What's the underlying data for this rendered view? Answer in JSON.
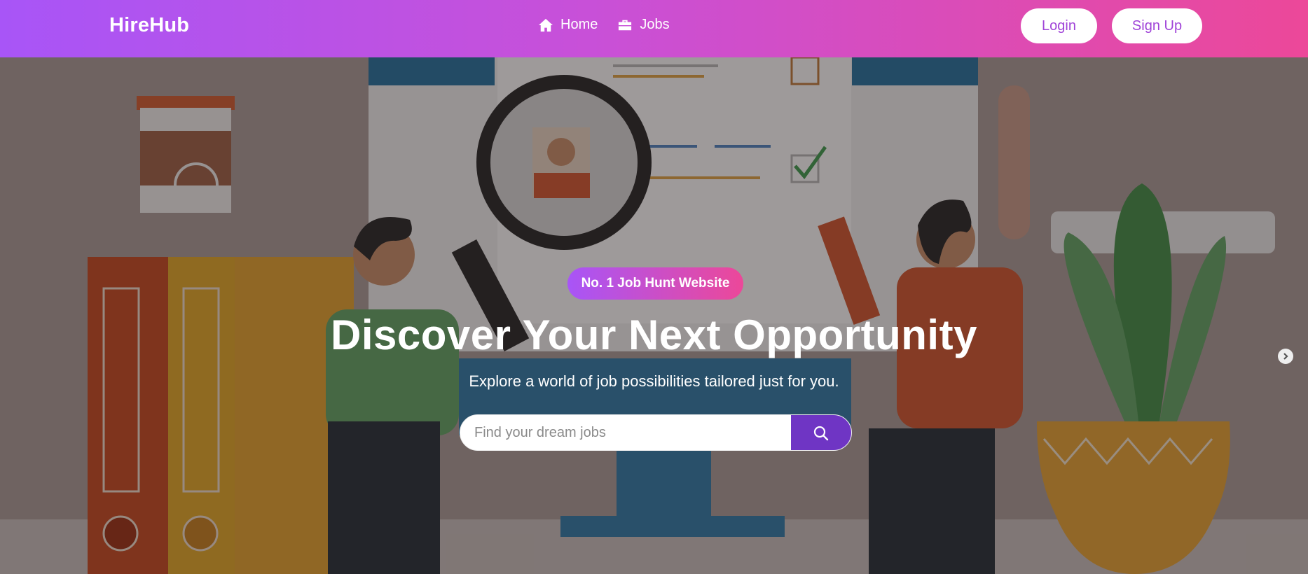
{
  "nav": {
    "brand": "HireHub",
    "links": [
      {
        "label": "Home",
        "icon": "home-icon"
      },
      {
        "label": "Jobs",
        "icon": "briefcase-icon"
      }
    ],
    "login_label": "Login",
    "signup_label": "Sign Up"
  },
  "hero": {
    "badge": "No. 1 Job Hunt Website",
    "title": "Discover Your Next Opportunity",
    "subtitle": "Explore a world of job possibilities tailored just for you.",
    "search_placeholder": "Find your dream jobs",
    "search_icon": "search-icon",
    "next_icon": "chevron-right-icon"
  },
  "colors": {
    "gradient_start": "#a855f7",
    "gradient_end": "#ec4899",
    "search_button": "#6f35c4",
    "pill_text": "#a044d8"
  }
}
